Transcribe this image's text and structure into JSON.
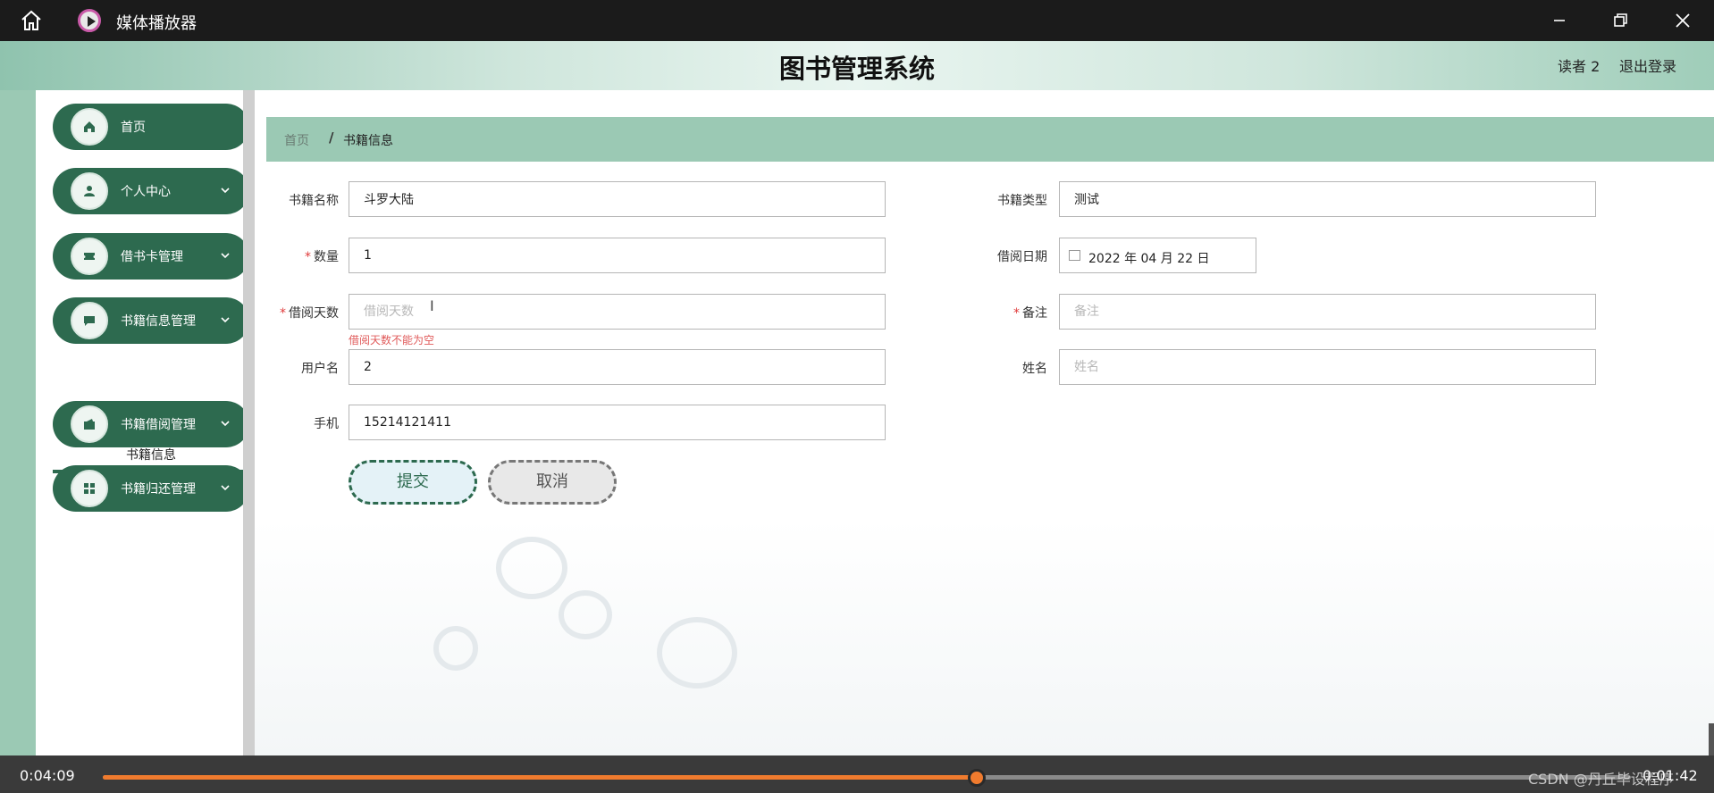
{
  "player": {
    "title": "媒体播放器",
    "current_time": "0:04:09",
    "total_time": "0:01:42",
    "progress": 0.572,
    "watermark": "CSDN @丹丘毕设程序",
    "accent_color": "#f07b2e"
  },
  "header": {
    "title": "图书管理系统",
    "user": "读者 2",
    "logout": "退出登录"
  },
  "sidebar": {
    "items": [
      {
        "label": "首页",
        "icon": "home-icon"
      },
      {
        "label": "个人中心",
        "icon": "user-icon"
      },
      {
        "label": "借书卡管理",
        "icon": "ticket-icon"
      },
      {
        "label": "书籍信息管理",
        "icon": "chat-icon"
      },
      {
        "label": "书籍借阅管理",
        "icon": "wallet-icon"
      },
      {
        "label": "书籍归还管理",
        "icon": "grid-icon"
      }
    ],
    "sub_item": "书籍信息",
    "brand_color": "#2d6a4f"
  },
  "breadcrumb": {
    "home": "首页",
    "separator": "/",
    "current": "书籍信息"
  },
  "form": {
    "book_name": {
      "label": "书籍名称",
      "value": "斗罗大陆"
    },
    "book_type": {
      "label": "书籍类型",
      "value": "测试"
    },
    "quantity": {
      "label": "数量",
      "value": "1"
    },
    "borrow_date": {
      "label": "借阅日期",
      "value": "2022 年 04 月 22 日"
    },
    "borrow_days": {
      "label": "借阅天数",
      "placeholder": "借阅天数",
      "error": "借阅天数不能为空"
    },
    "remark": {
      "label": "备注",
      "placeholder": "备注"
    },
    "username": {
      "label": "用户名",
      "value": "2"
    },
    "name": {
      "label": "姓名",
      "placeholder": "姓名"
    },
    "phone": {
      "label": "手机",
      "value": "15214121411"
    },
    "submit": "提交",
    "cancel": "取消",
    "required_mark": "*"
  }
}
